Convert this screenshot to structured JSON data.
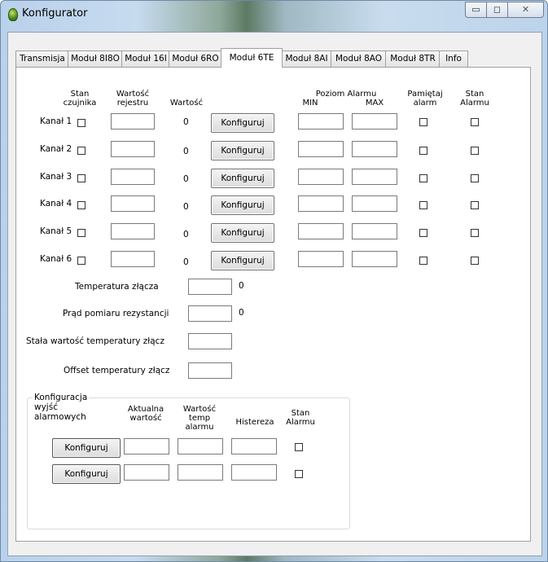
{
  "window": {
    "title": "Konfigurator",
    "controls": {
      "minimize": "▭",
      "maximize": "◻",
      "close": "✕"
    }
  },
  "tabs": [
    "Transmisja",
    "Moduł 8I8O",
    "Moduł 16I",
    "Moduł 6RO",
    "Moduł 6TE",
    "Moduł 8AI",
    "Moduł 8AO",
    "Moduł 8TR",
    "Info"
  ],
  "active_tab": "Moduł 6TE",
  "headers": {
    "stan_czujnika": [
      "Stan",
      "czujnika"
    ],
    "wartosc_rejestru": [
      "Wartość",
      "rejestru"
    ],
    "wartosc": "Wartość",
    "poziom_alarmu": "Poziom Alarmu",
    "min": "MIN",
    "max": "MAX",
    "pamietaj_alarm": [
      "Pamiętaj",
      "alarm"
    ],
    "stan_alarmu": [
      "Stan",
      "Alarmu"
    ]
  },
  "channels": [
    {
      "label": "Kanał 1",
      "value": "0",
      "button": "Konfiguruj"
    },
    {
      "label": "Kanał 2",
      "value": "0",
      "button": "Konfiguruj"
    },
    {
      "label": "Kanał 3",
      "value": "0",
      "button": "Konfiguruj"
    },
    {
      "label": "Kanał 4",
      "value": "0",
      "button": "Konfiguruj"
    },
    {
      "label": "Kanał 5",
      "value": "0",
      "button": "Konfiguruj"
    },
    {
      "label": "Kanał 6",
      "value": "0",
      "button": "Konfiguruj"
    }
  ],
  "fields": {
    "temperatura_zlacza": {
      "label": "Temperatura złącza",
      "value": "0"
    },
    "prad_pomiaru": {
      "label": "Prąd pomiaru rezystancji",
      "value": "0"
    },
    "stala_wartosc": {
      "label": "Stała wartość temperatury złącz"
    },
    "offset": {
      "label": "Offset temperatury złącz"
    }
  },
  "alarm_outputs": {
    "title": "Konfiguracja wyjść alarmowych",
    "headers": {
      "aktualna": [
        "Aktualna",
        "wartość"
      ],
      "wartosc_temp": [
        "Wartość temp",
        "alarmu"
      ],
      "histereza": "Histereza",
      "stan_alarmu": [
        "Stan",
        "Alarmu"
      ]
    },
    "rows": [
      {
        "button": "Konfiguruj"
      },
      {
        "button": "Konfiguruj"
      }
    ]
  }
}
